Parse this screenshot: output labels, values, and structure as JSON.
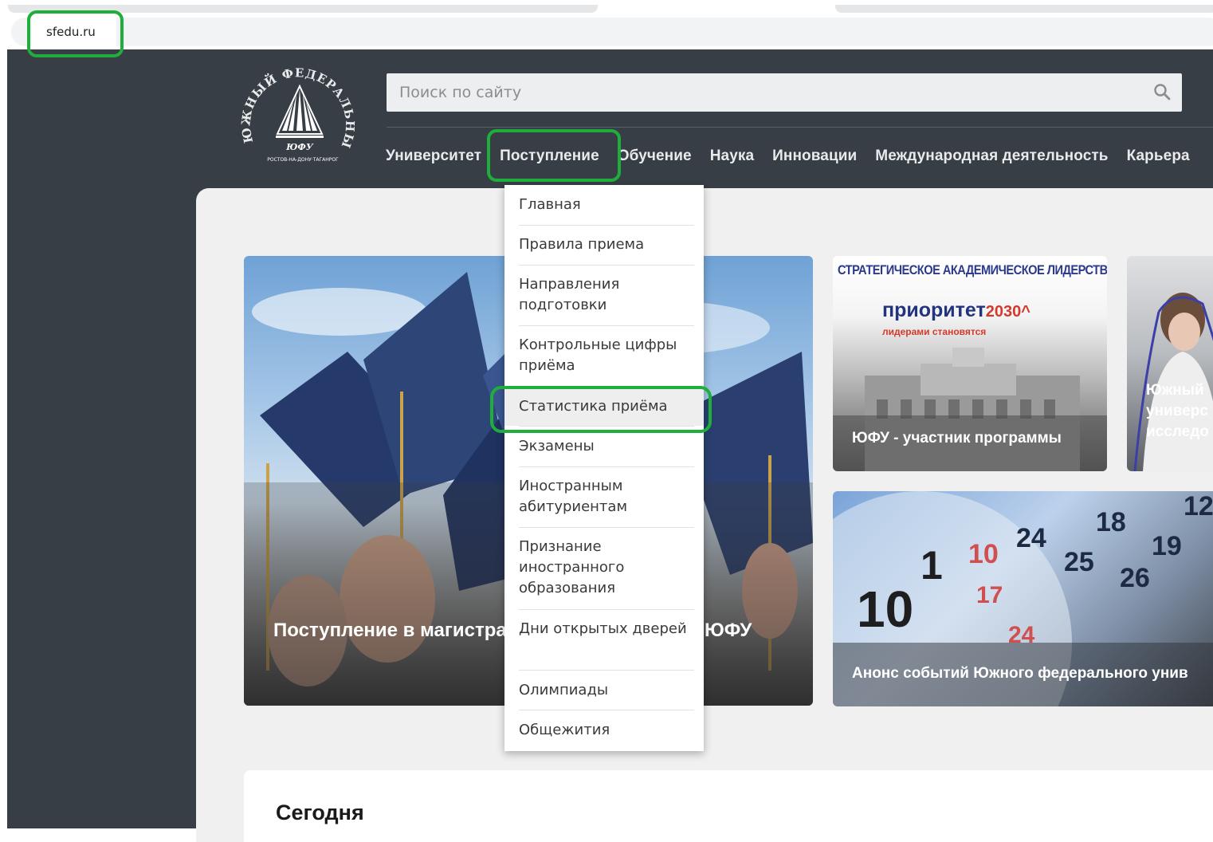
{
  "browser": {
    "url": "sfedu.ru"
  },
  "header": {
    "search_placeholder": "Поиск по сайту",
    "nav": [
      "Университет",
      "Поступление",
      "Обучение",
      "Наука",
      "Инновации",
      "Международная деятельность",
      "Карьера"
    ]
  },
  "logo": {
    "ring_text": "ЮЖНЫЙ ФЕДЕРАЛЬНЫЙ УНИВЕРСИТЕТ",
    "center_text": "ЮФУ",
    "city_text": "РОСТОВ-НА-ДОНУ·ТАГАНРОГ"
  },
  "dropdown": {
    "items": [
      "Главная",
      "Правила приема",
      "Направления подготовки",
      "Контрольные цифры приёма",
      "Статистика приёма",
      "Экзамены",
      "Иностранным абитуриентам",
      "Признание иностранного образования",
      "Дни открытых дверей",
      "Олимпиады",
      "Общежития"
    ]
  },
  "hero": {
    "caption_left": "Поступление в магистра",
    "caption_right": "ЮФУ"
  },
  "cards": {
    "card1_heading": "СТРАТЕГИЧЕСКОЕ АКАДЕМИЧЕСКОЕ ЛИДЕРСТВО",
    "card1_logo_main": "приоритет",
    "card1_logo_year": "2030^",
    "card1_logo_sub": "лидерами становятся",
    "card1_caption": "ЮФУ - участник программы",
    "card2_caption_line1": "Южный",
    "card2_caption_line2": "универс",
    "card2_caption_line3": "исследо",
    "card3_caption": "Анонс событий Южного федерального унив"
  },
  "section": {
    "today": "Сегодня"
  }
}
